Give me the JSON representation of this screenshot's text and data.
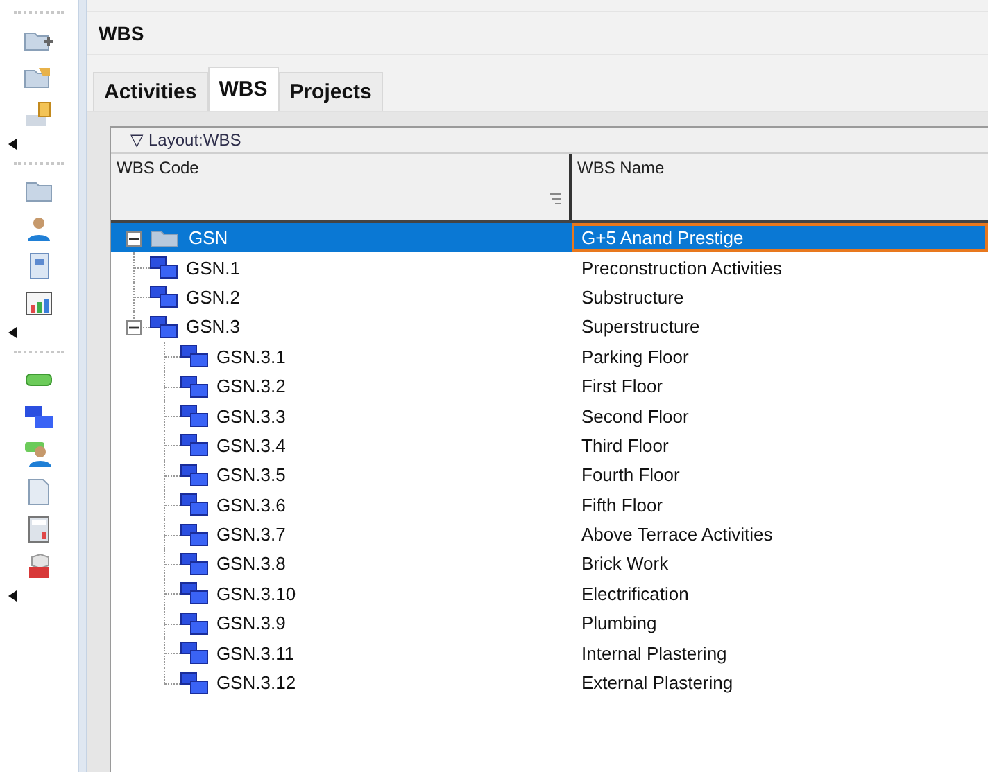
{
  "panel": {
    "title": "WBS"
  },
  "tabs": [
    {
      "label": "Activities",
      "selected": false
    },
    {
      "label": "WBS",
      "selected": true
    },
    {
      "label": "Projects",
      "selected": false
    }
  ],
  "layout_bar": {
    "toggle": "▽",
    "label": "Layout:WBS"
  },
  "table": {
    "columns": [
      "WBS Code",
      "WBS Name"
    ],
    "rows": [
      {
        "kind": "project",
        "code": "GSN",
        "name": "G+5 Anand Prestige",
        "selected": true,
        "expanded": true,
        "children": [
          {
            "kind": "wbs",
            "code": "GSN.1",
            "name": "Preconstruction Activities",
            "selected": false
          },
          {
            "kind": "wbs",
            "code": "GSN.2",
            "name": "Substructure",
            "selected": false
          },
          {
            "kind": "wbs",
            "code": "GSN.3",
            "name": "Superstructure",
            "selected": false,
            "expanded": true,
            "children": [
              {
                "kind": "wbs",
                "code": "GSN.3.1",
                "name": "Parking Floor",
                "selected": false
              },
              {
                "kind": "wbs",
                "code": "GSN.3.2",
                "name": "First Floor",
                "selected": false
              },
              {
                "kind": "wbs",
                "code": "GSN.3.3",
                "name": "Second Floor",
                "selected": false
              },
              {
                "kind": "wbs",
                "code": "GSN.3.4",
                "name": "Third Floor",
                "selected": false
              },
              {
                "kind": "wbs",
                "code": "GSN.3.5",
                "name": "Fourth Floor",
                "selected": false
              },
              {
                "kind": "wbs",
                "code": "GSN.3.6",
                "name": "Fifth Floor",
                "selected": false
              },
              {
                "kind": "wbs",
                "code": "GSN.3.7",
                "name": "Above Terrace Activities",
                "selected": false
              },
              {
                "kind": "wbs",
                "code": "GSN.3.8",
                "name": "Brick Work",
                "selected": false
              },
              {
                "kind": "wbs",
                "code": "GSN.3.10",
                "name": "Electrification",
                "selected": false
              },
              {
                "kind": "wbs",
                "code": "GSN.3.9",
                "name": "Plumbing",
                "selected": false
              },
              {
                "kind": "wbs",
                "code": "GSN.3.11",
                "name": "Internal Plastering",
                "selected": false
              },
              {
                "kind": "wbs",
                "code": "GSN.3.12",
                "name": "External Plastering",
                "selected": false
              }
            ]
          }
        ]
      }
    ]
  }
}
